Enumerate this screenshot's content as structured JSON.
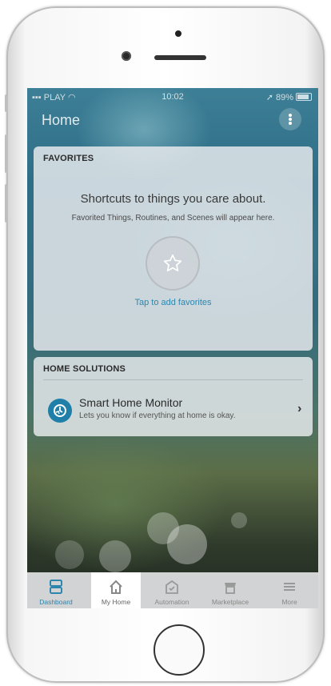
{
  "status_bar": {
    "carrier": "PLAY",
    "time": "10:02",
    "battery": "89%"
  },
  "header": {
    "title": "Home"
  },
  "favorites": {
    "header": "FAVORITES",
    "title": "Shortcuts to things you care about.",
    "subtitle": "Favorited Things, Routines, and Scenes will appear here.",
    "link": "Tap to add favorites"
  },
  "solutions": {
    "header": "HOME SOLUTIONS",
    "items": [
      {
        "title": "Smart Home Monitor",
        "subtitle": "Lets you know if everything at home is okay."
      }
    ]
  },
  "tabs": [
    {
      "label": "Dashboard",
      "icon": "dashboard-icon"
    },
    {
      "label": "My Home",
      "icon": "house-icon"
    },
    {
      "label": "Automation",
      "icon": "automation-icon"
    },
    {
      "label": "Marketplace",
      "icon": "marketplace-icon"
    },
    {
      "label": "More",
      "icon": "hamburger-menu-icon"
    }
  ],
  "colors": {
    "accent": "#2f86ad",
    "shm_icon": "#1f7fa8",
    "card": "#e9ecee"
  }
}
